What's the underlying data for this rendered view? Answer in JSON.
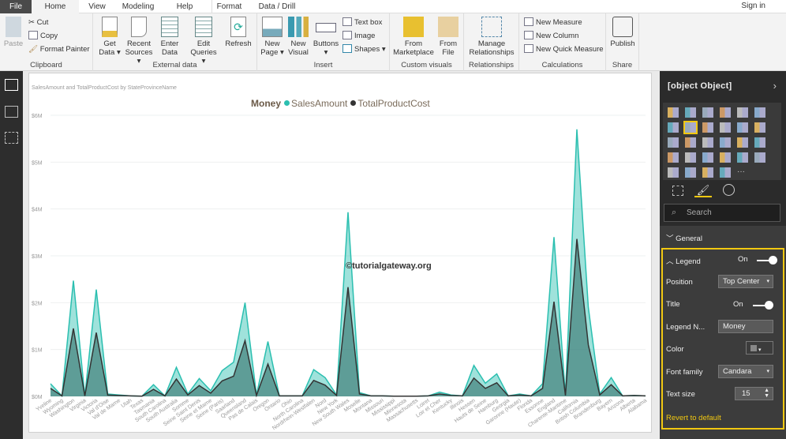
{
  "tabs": {
    "file": "File",
    "home": "Home",
    "view": "View",
    "modeling": "Modeling",
    "help": "Help",
    "format": "Format",
    "data_drill": "Data / Drill",
    "sign_in": "Sign in"
  },
  "ribbon": {
    "clipboard": {
      "label": "Clipboard",
      "paste": "Paste",
      "cut": "Cut",
      "copy": "Copy",
      "format_painter": "Format Painter"
    },
    "external": {
      "label": "External data",
      "get_data": "Get Data",
      "recent": "Recent Sources",
      "enter": "Enter Data",
      "edit": "Edit Queries",
      "refresh": "Refresh"
    },
    "insert": {
      "label": "Insert",
      "new_page": "New Page",
      "new_visual": "New Visual",
      "buttons": "Buttons",
      "text_box": "Text box",
      "image": "Image",
      "shapes": "Shapes"
    },
    "custom": {
      "label": "Custom visuals",
      "marketplace": "From Marketplace",
      "file": "From File"
    },
    "relationships": {
      "label": "Relationships",
      "manage": "Manage Relationships"
    },
    "calculations": {
      "label": "Calculations",
      "new_measure": "New Measure",
      "new_column": "New Column",
      "quick_measure": "New Quick Measure"
    },
    "share": {
      "label": "Share",
      "publish": "Publish"
    }
  },
  "visual": {
    "title": "SalesAmount and TotalProductCost by StateProvinceName",
    "watermark": "©tutorialgateway.org"
  },
  "chart_data": {
    "type": "area",
    "title": "SalesAmount and TotalProductCost by StateProvinceName",
    "legend": {
      "title": "Money",
      "position": "top-center"
    },
    "categories": [
      "Yveline",
      "Wyoming",
      "Washington",
      "Virginia",
      "Victoria",
      "Val d'Oise",
      "Val de Marne",
      "Utah",
      "Texas",
      "Tasmania",
      "South Carolina",
      "South Australia",
      "Somme",
      "Seine Saint Denis",
      "Seine et Marne",
      "Seine (Paris)",
      "Saarland",
      "Queensland",
      "Pas de Calais",
      "Oregon",
      "Ontario",
      "Ohio",
      "North Carolina",
      "Nordrhein-Westfalen",
      "Nord",
      "New York",
      "New South Wales",
      "Moselle",
      "Montana",
      "Missouri",
      "Mississippi",
      "Minnesota",
      "Massachusetts",
      "Loiret",
      "Loir et Cher",
      "Kentucky",
      "Illinois",
      "Hessen",
      "Hauts de Seine",
      "Hamburg",
      "Georgia",
      "Garonne (Haute)",
      "Florida",
      "Essonne",
      "England",
      "Charente-Maritime",
      "California",
      "British Columbia",
      "Brandenburg",
      "Bayern",
      "Arizona",
      "Alberta",
      "Alabama"
    ],
    "series": [
      {
        "name": "SalesAmount",
        "color": "#2bbfb0",
        "values": [
          0.27,
          0.01,
          2.47,
          0.01,
          2.28,
          0.05,
          0.03,
          0.01,
          0.005,
          0.25,
          0.01,
          0.62,
          0.05,
          0.38,
          0.12,
          0.55,
          0.73,
          2.0,
          0.03,
          1.17,
          0.01,
          0.01,
          0.01,
          0.57,
          0.4,
          0.03,
          3.93,
          0.08,
          0.01,
          0.01,
          0.005,
          0.005,
          0.005,
          0.01,
          0.09,
          0.03,
          0.01,
          0.66,
          0.28,
          0.48,
          0.01,
          0.05,
          0.01,
          0.27,
          3.4,
          0.02,
          5.7,
          1.9,
          0.05,
          0.4,
          0.01,
          0.02,
          0.01
        ]
      },
      {
        "name": "TotalProductCost",
        "color": "#333333",
        "values": [
          0.17,
          0.01,
          1.45,
          0.01,
          1.36,
          0.03,
          0.02,
          0.01,
          0.005,
          0.15,
          0.01,
          0.37,
          0.03,
          0.23,
          0.07,
          0.33,
          0.43,
          1.19,
          0.02,
          0.69,
          0.01,
          0.01,
          0.01,
          0.34,
          0.24,
          0.02,
          2.33,
          0.05,
          0.01,
          0.01,
          0.005,
          0.005,
          0.005,
          0.01,
          0.05,
          0.02,
          0.01,
          0.39,
          0.17,
          0.29,
          0.01,
          0.03,
          0.01,
          0.17,
          2.02,
          0.02,
          3.36,
          1.1,
          0.03,
          0.25,
          0.01,
          0.02,
          0.01
        ]
      }
    ],
    "yticks": [
      "$0M",
      "$1M",
      "$2M",
      "$3M",
      "$4M",
      "$5M",
      "$6M"
    ],
    "ylim": [
      0,
      6
    ],
    "unit": "millions USD",
    "grid": true
  },
  "panel": {
    "title": {
      "label": "Title",
      "state": "On"
    },
    "search_placeholder": "Search",
    "general": "General",
    "legend": {
      "label": "Legend",
      "state": "On"
    },
    "position": {
      "label": "Position",
      "value": "Top Center"
    },
    "legend_name": {
      "label": "Legend N...",
      "value": "Money"
    },
    "color": {
      "label": "Color"
    },
    "font_family": {
      "label": "Font family",
      "value": "Candara"
    },
    "text_size": {
      "label": "Text size",
      "value": "15"
    },
    "revert": "Revert to default"
  }
}
